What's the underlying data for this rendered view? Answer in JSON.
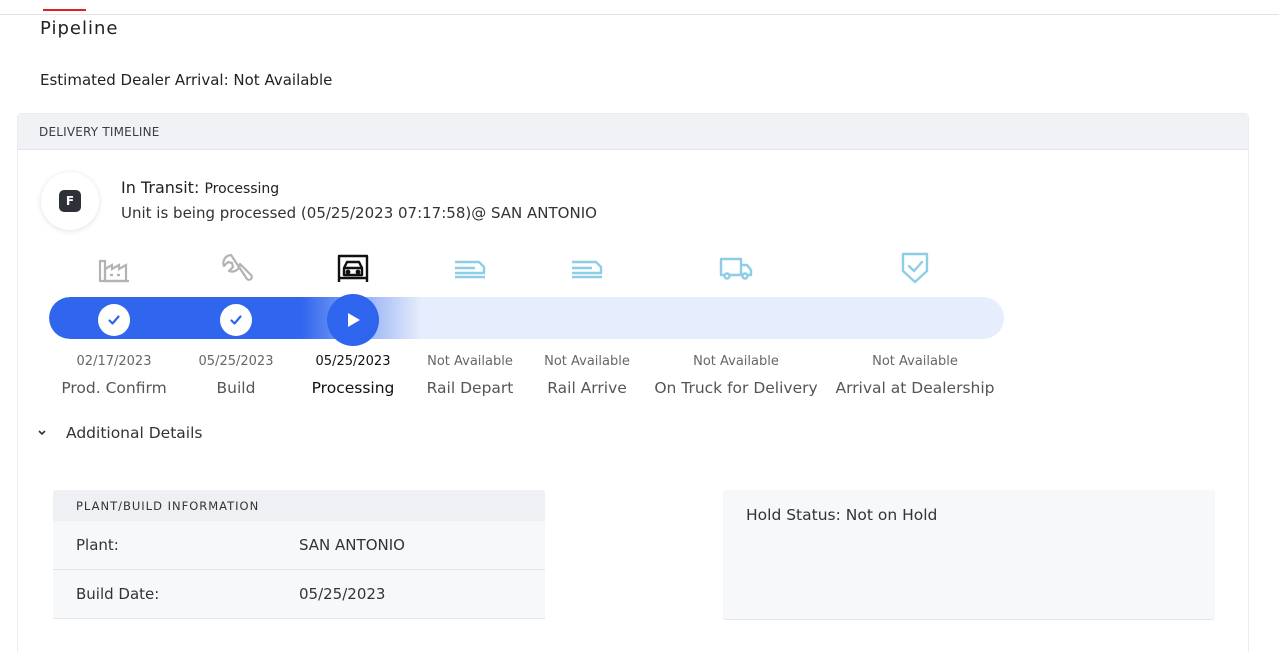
{
  "page": {
    "tab_label": "Pipeline",
    "estimated_arrival": "Estimated Dealer Arrival: Not Available"
  },
  "colors": {
    "brand_red": "#e02020",
    "progress_blue": "#3066ee",
    "track_light": "#e6edfc",
    "icon_done": "#b3b3b3",
    "icon_pending": "#8ecde6"
  },
  "timeline": {
    "header": "DELIVERY TIMELINE",
    "avatar_letter": "F",
    "status_label": "In Transit:",
    "status_value": "Processing",
    "status_detail": "Unit is being processed (05/25/2023 07:17:58)@ SAN ANTONIO",
    "progress_fraction": 0.39,
    "steps": [
      {
        "icon": "factory-icon",
        "date": "02/17/2023",
        "label": "Prod. Confirm",
        "state": "done"
      },
      {
        "icon": "wrench-icon",
        "date": "05/25/2023",
        "label": "Build",
        "state": "done"
      },
      {
        "icon": "car-lift-icon",
        "date": "05/25/2023",
        "label": "Processing",
        "state": "current"
      },
      {
        "icon": "rail-car-icon",
        "date": "Not Available",
        "label": "Rail Depart",
        "state": "pending"
      },
      {
        "icon": "rail-car-icon",
        "date": "Not Available",
        "label": "Rail Arrive",
        "state": "pending"
      },
      {
        "icon": "truck-icon",
        "date": "Not Available",
        "label": "On Truck for Delivery",
        "state": "pending"
      },
      {
        "icon": "shield-check-icon",
        "date": "Not Available",
        "label": "Arrival at Dealership",
        "state": "pending"
      }
    ]
  },
  "details": {
    "toggle_label": "Additional Details",
    "plant_header": "PLANT/BUILD INFORMATION",
    "rows": [
      {
        "key": "Plant:",
        "value": "SAN ANTONIO"
      },
      {
        "key": "Build Date:",
        "value": "05/25/2023"
      }
    ],
    "hold_status": "Hold Status: Not on Hold"
  }
}
